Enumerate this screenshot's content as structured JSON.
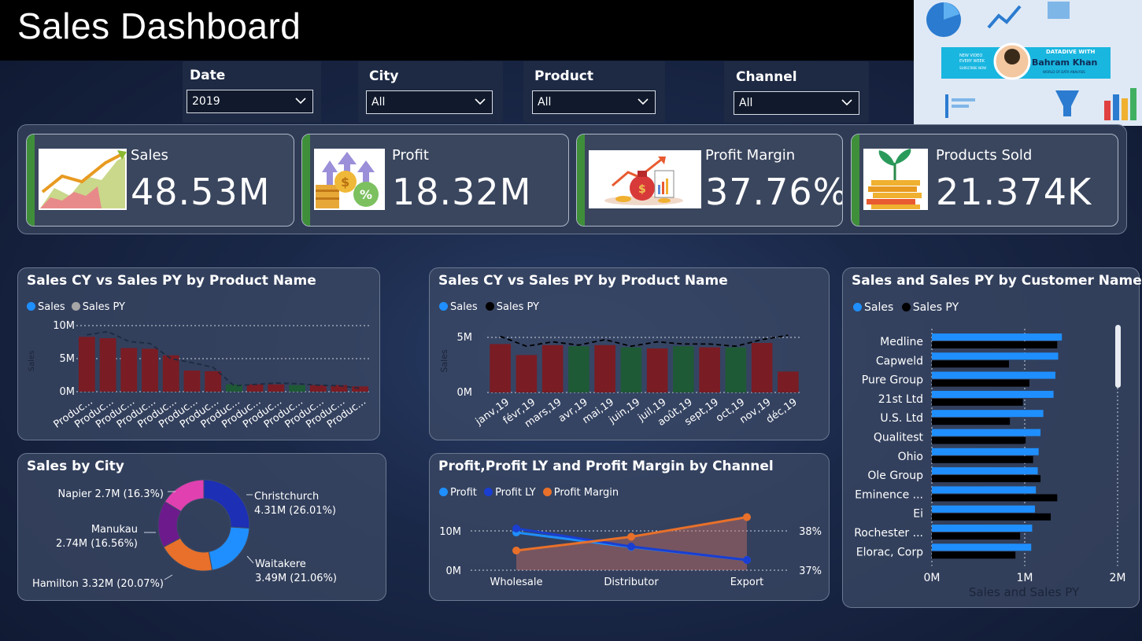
{
  "header": {
    "title": "Sales Dashboard"
  },
  "banner": {
    "line1": "DATADIVE WITH",
    "name": "Bahram Khan",
    "sub": "WORLD OF DATA ANALYSIS",
    "promo1": "NEW VIDEO",
    "promo2": "EVERY WEEK",
    "button": "SUBSCRIBE NOW"
  },
  "filters": [
    {
      "label": "Date",
      "value": "2019"
    },
    {
      "label": "City",
      "value": "All"
    },
    {
      "label": "Product",
      "value": "All"
    },
    {
      "label": "Channel",
      "value": "All"
    }
  ],
  "kpis": [
    {
      "label": "Sales",
      "value": "48.53M",
      "icon": "growth-chart-icon"
    },
    {
      "label": "Profit",
      "value": "18.32M",
      "icon": "coins-percent-icon"
    },
    {
      "label": "Profit Margin",
      "value": "37.76%",
      "icon": "money-bag-report-icon"
    },
    {
      "label": "Products Sold",
      "value": "21.374K",
      "icon": "plant-coins-icon"
    }
  ],
  "colors": {
    "sales": "#1f8fff",
    "sales_py_gray": "#a6a6a6",
    "sales_py_black": "#000000",
    "bar_red": "#7a1c24",
    "bar_green": "#1f5a36",
    "profit_ly": "#1a3ed1",
    "profit_margin": "#e8702a",
    "kpi_accent": "#3f8f3a"
  },
  "chart_data": [
    {
      "type": "bar",
      "title": "Sales CY vs Sales PY by Product Name",
      "legend": [
        "Sales",
        "Sales PY"
      ],
      "ylabel": "Sales",
      "yticks": [
        "10M",
        "5M",
        "0M"
      ],
      "ylim": [
        0,
        10
      ],
      "categories": [
        "Produc...",
        "Produc...",
        "Produc...",
        "Produc...",
        "Produc...",
        "Produc...",
        "Produc...",
        "Produc...",
        "Produc...",
        "Produc...",
        "Produc...",
        "Produc...",
        "Produc...",
        "Produc..."
      ],
      "series": [
        {
          "name": "Sales",
          "values": [
            8.3,
            8.1,
            6.6,
            6.5,
            5.5,
            3.2,
            3.1,
            1.1,
            1.1,
            1.1,
            1.0,
            1.0,
            1.0,
            0.8
          ],
          "colors": [
            "r",
            "r",
            "r",
            "r",
            "r",
            "r",
            "r",
            "g",
            "r",
            "r",
            "g",
            "r",
            "r",
            "r"
          ]
        },
        {
          "name": "Sales PY",
          "values": [
            8.6,
            9.1,
            7.6,
            7.3,
            5.0,
            4.4,
            3.7,
            0.9,
            1.1,
            1.3,
            1.2,
            1.0,
            0.9,
            0.5
          ]
        }
      ]
    },
    {
      "type": "bar",
      "title": "Sales CY vs Sales PY by Product Name",
      "legend": [
        "Sales",
        "Sales PY"
      ],
      "ylabel": "Sales",
      "yticks": [
        "5M",
        "0M"
      ],
      "ylim": [
        0,
        5
      ],
      "categories": [
        "janv,19",
        "févr,19",
        "mars,19",
        "avr,19",
        "mai,19",
        "juin,19",
        "juil,19",
        "août,19",
        "sept,19",
        "oct,19",
        "nov,19",
        "déc,19"
      ],
      "series": [
        {
          "name": "Sales",
          "values": [
            4.4,
            3.4,
            4.3,
            4.2,
            4.3,
            4.1,
            4.0,
            4.2,
            4.1,
            4.1,
            4.5,
            1.9
          ],
          "colors": [
            "r",
            "r",
            "r",
            "g",
            "r",
            "g",
            "r",
            "g",
            "r",
            "g",
            "r",
            "r"
          ]
        },
        {
          "name": "Sales PY",
          "values": [
            5.1,
            4.2,
            4.6,
            4.3,
            4.8,
            4.2,
            4.6,
            4.4,
            4.4,
            4.2,
            4.8,
            5.2
          ]
        }
      ]
    },
    {
      "type": "bar",
      "title": "Sales and Sales PY by Customer Names",
      "legend": [
        "Sales",
        "Sales PY"
      ],
      "xlabel": "Sales and Sales PY",
      "xticks": [
        "0M",
        "1M",
        "2M"
      ],
      "xlim": [
        0,
        2
      ],
      "categories": [
        "Medline",
        "Capweld",
        "Pure Group",
        "21st Ltd",
        "U.S. Ltd",
        "Qualitest",
        "Ohio",
        "Ole Group",
        "Eminence ...",
        "Ei",
        "Rochester ...",
        "Elorac, Corp"
      ],
      "series": [
        {
          "name": "Sales",
          "values": [
            1.4,
            1.36,
            1.33,
            1.31,
            1.2,
            1.17,
            1.15,
            1.14,
            1.12,
            1.11,
            1.08,
            1.07
          ]
        },
        {
          "name": "Sales PY",
          "values": [
            1.35,
            0.83,
            1.05,
            0.98,
            0.84,
            1.01,
            1.09,
            1.17,
            1.35,
            1.28,
            0.95,
            0.9
          ]
        }
      ]
    },
    {
      "type": "pie",
      "title": "Sales by City",
      "slices": [
        {
          "label": "Christchurch",
          "value": "4.31M (26.01%)",
          "percent": 26.01,
          "color": "#1c2fb5"
        },
        {
          "label": "Waitakere",
          "value": "3.49M (21.06%)",
          "percent": 21.06,
          "color": "#1f8fff"
        },
        {
          "label": "Hamilton",
          "value": "3.32M (20.07%)",
          "percent": 20.07,
          "color": "#e8702a"
        },
        {
          "label": "Manukau",
          "value": "2.74M (16.56%)",
          "percent": 16.56,
          "color": "#6d1a8c"
        },
        {
          "label": "Napier",
          "value": "2.7M (16.3%)",
          "percent": 16.3,
          "color": "#e040b0"
        }
      ]
    },
    {
      "type": "line",
      "title": "Profit,Profit LY and Profit Margin by Channel",
      "legend": [
        "Profit",
        "Profit LY",
        "Profit Margin"
      ],
      "categories": [
        "Wholesale",
        "Distributor",
        "Export"
      ],
      "yticks_left": [
        "10M",
        "0M"
      ],
      "yticks_right": [
        "38%",
        "37%"
      ],
      "ylim_left": [
        0,
        10
      ],
      "ylim_right": [
        37,
        38
      ],
      "series": [
        {
          "name": "Profit",
          "values": [
            9.6,
            5.9,
            2.6
          ]
        },
        {
          "name": "Profit LY",
          "values": [
            10.6,
            6.0,
            2.6
          ]
        },
        {
          "name": "Profit Margin",
          "values": [
            37.5,
            37.85,
            38.35
          ]
        }
      ]
    }
  ]
}
